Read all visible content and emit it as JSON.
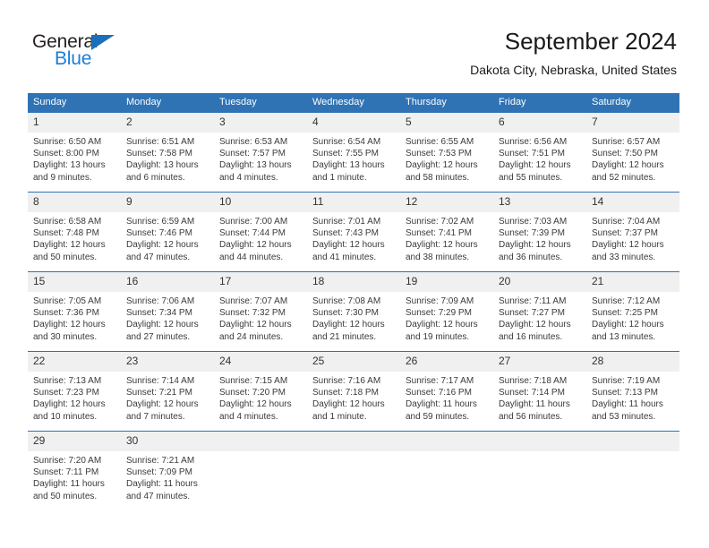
{
  "brand": {
    "word_one": "General",
    "word_two": "Blue",
    "triangle_icon": "triangle-icon",
    "colors": {
      "dark": "#231f20",
      "blue": "#1b7ed6",
      "triangle": "#1b6fba"
    }
  },
  "header": {
    "title": "September 2024",
    "subtitle": "Dakota City, Nebraska, United States"
  },
  "theme": {
    "header_blue": "#2f73b4",
    "daynum_gray": "#f0f0f0",
    "text": "#3a3a3a"
  },
  "weekdays": [
    "Sunday",
    "Monday",
    "Tuesday",
    "Wednesday",
    "Thursday",
    "Friday",
    "Saturday"
  ],
  "labels": {
    "sunrise": "Sunrise:",
    "sunset": "Sunset:",
    "daylight": "Daylight:"
  },
  "weeks": [
    [
      {
        "day": "1",
        "sunrise": "Sunrise: 6:50 AM",
        "sunset": "Sunset: 8:00 PM",
        "daylight": "Daylight: 13 hours and 9 minutes."
      },
      {
        "day": "2",
        "sunrise": "Sunrise: 6:51 AM",
        "sunset": "Sunset: 7:58 PM",
        "daylight": "Daylight: 13 hours and 6 minutes."
      },
      {
        "day": "3",
        "sunrise": "Sunrise: 6:53 AM",
        "sunset": "Sunset: 7:57 PM",
        "daylight": "Daylight: 13 hours and 4 minutes."
      },
      {
        "day": "4",
        "sunrise": "Sunrise: 6:54 AM",
        "sunset": "Sunset: 7:55 PM",
        "daylight": "Daylight: 13 hours and 1 minute."
      },
      {
        "day": "5",
        "sunrise": "Sunrise: 6:55 AM",
        "sunset": "Sunset: 7:53 PM",
        "daylight": "Daylight: 12 hours and 58 minutes."
      },
      {
        "day": "6",
        "sunrise": "Sunrise: 6:56 AM",
        "sunset": "Sunset: 7:51 PM",
        "daylight": "Daylight: 12 hours and 55 minutes."
      },
      {
        "day": "7",
        "sunrise": "Sunrise: 6:57 AM",
        "sunset": "Sunset: 7:50 PM",
        "daylight": "Daylight: 12 hours and 52 minutes."
      }
    ],
    [
      {
        "day": "8",
        "sunrise": "Sunrise: 6:58 AM",
        "sunset": "Sunset: 7:48 PM",
        "daylight": "Daylight: 12 hours and 50 minutes."
      },
      {
        "day": "9",
        "sunrise": "Sunrise: 6:59 AM",
        "sunset": "Sunset: 7:46 PM",
        "daylight": "Daylight: 12 hours and 47 minutes."
      },
      {
        "day": "10",
        "sunrise": "Sunrise: 7:00 AM",
        "sunset": "Sunset: 7:44 PM",
        "daylight": "Daylight: 12 hours and 44 minutes."
      },
      {
        "day": "11",
        "sunrise": "Sunrise: 7:01 AM",
        "sunset": "Sunset: 7:43 PM",
        "daylight": "Daylight: 12 hours and 41 minutes."
      },
      {
        "day": "12",
        "sunrise": "Sunrise: 7:02 AM",
        "sunset": "Sunset: 7:41 PM",
        "daylight": "Daylight: 12 hours and 38 minutes."
      },
      {
        "day": "13",
        "sunrise": "Sunrise: 7:03 AM",
        "sunset": "Sunset: 7:39 PM",
        "daylight": "Daylight: 12 hours and 36 minutes."
      },
      {
        "day": "14",
        "sunrise": "Sunrise: 7:04 AM",
        "sunset": "Sunset: 7:37 PM",
        "daylight": "Daylight: 12 hours and 33 minutes."
      }
    ],
    [
      {
        "day": "15",
        "sunrise": "Sunrise: 7:05 AM",
        "sunset": "Sunset: 7:36 PM",
        "daylight": "Daylight: 12 hours and 30 minutes."
      },
      {
        "day": "16",
        "sunrise": "Sunrise: 7:06 AM",
        "sunset": "Sunset: 7:34 PM",
        "daylight": "Daylight: 12 hours and 27 minutes."
      },
      {
        "day": "17",
        "sunrise": "Sunrise: 7:07 AM",
        "sunset": "Sunset: 7:32 PM",
        "daylight": "Daylight: 12 hours and 24 minutes."
      },
      {
        "day": "18",
        "sunrise": "Sunrise: 7:08 AM",
        "sunset": "Sunset: 7:30 PM",
        "daylight": "Daylight: 12 hours and 21 minutes."
      },
      {
        "day": "19",
        "sunrise": "Sunrise: 7:09 AM",
        "sunset": "Sunset: 7:29 PM",
        "daylight": "Daylight: 12 hours and 19 minutes."
      },
      {
        "day": "20",
        "sunrise": "Sunrise: 7:11 AM",
        "sunset": "Sunset: 7:27 PM",
        "daylight": "Daylight: 12 hours and 16 minutes."
      },
      {
        "day": "21",
        "sunrise": "Sunrise: 7:12 AM",
        "sunset": "Sunset: 7:25 PM",
        "daylight": "Daylight: 12 hours and 13 minutes."
      }
    ],
    [
      {
        "day": "22",
        "sunrise": "Sunrise: 7:13 AM",
        "sunset": "Sunset: 7:23 PM",
        "daylight": "Daylight: 12 hours and 10 minutes."
      },
      {
        "day": "23",
        "sunrise": "Sunrise: 7:14 AM",
        "sunset": "Sunset: 7:21 PM",
        "daylight": "Daylight: 12 hours and 7 minutes."
      },
      {
        "day": "24",
        "sunrise": "Sunrise: 7:15 AM",
        "sunset": "Sunset: 7:20 PM",
        "daylight": "Daylight: 12 hours and 4 minutes."
      },
      {
        "day": "25",
        "sunrise": "Sunrise: 7:16 AM",
        "sunset": "Sunset: 7:18 PM",
        "daylight": "Daylight: 12 hours and 1 minute."
      },
      {
        "day": "26",
        "sunrise": "Sunrise: 7:17 AM",
        "sunset": "Sunset: 7:16 PM",
        "daylight": "Daylight: 11 hours and 59 minutes."
      },
      {
        "day": "27",
        "sunrise": "Sunrise: 7:18 AM",
        "sunset": "Sunset: 7:14 PM",
        "daylight": "Daylight: 11 hours and 56 minutes."
      },
      {
        "day": "28",
        "sunrise": "Sunrise: 7:19 AM",
        "sunset": "Sunset: 7:13 PM",
        "daylight": "Daylight: 11 hours and 53 minutes."
      }
    ],
    [
      {
        "day": "29",
        "sunrise": "Sunrise: 7:20 AM",
        "sunset": "Sunset: 7:11 PM",
        "daylight": "Daylight: 11 hours and 50 minutes."
      },
      {
        "day": "30",
        "sunrise": "Sunrise: 7:21 AM",
        "sunset": "Sunset: 7:09 PM",
        "daylight": "Daylight: 11 hours and 47 minutes."
      },
      {
        "day": "",
        "sunrise": "",
        "sunset": "",
        "daylight": ""
      },
      {
        "day": "",
        "sunrise": "",
        "sunset": "",
        "daylight": ""
      },
      {
        "day": "",
        "sunrise": "",
        "sunset": "",
        "daylight": ""
      },
      {
        "day": "",
        "sunrise": "",
        "sunset": "",
        "daylight": ""
      },
      {
        "day": "",
        "sunrise": "",
        "sunset": "",
        "daylight": ""
      }
    ]
  ]
}
